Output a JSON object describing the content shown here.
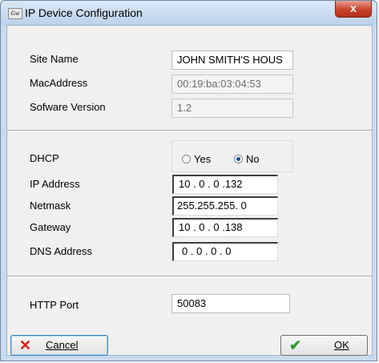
{
  "window": {
    "title": "IP Device Configuration",
    "app_icon_text": "Gw",
    "close_glyph": "x"
  },
  "device": {
    "site_name_label": "Site Name",
    "site_name_value": "JOHN SMITH'S HOUS",
    "mac_label": "MacAddress",
    "mac_value": "00:19:ba:03:04:53",
    "software_label": "Sofware Version",
    "software_value": "1.2"
  },
  "network": {
    "dhcp_label": "DHCP",
    "dhcp_yes_label": "Yes",
    "dhcp_no_label": "No",
    "dhcp_selected": "No",
    "ip_label": "IP Address",
    "ip_value": "10 . 0 . 0 .132",
    "netmask_label": "Netmask",
    "netmask_value": "255.255.255. 0",
    "gateway_label": "Gateway",
    "gateway_value": "10 . 0 . 0 .138",
    "dns_label": "DNS Address",
    "dns_value": "0 . 0 . 0 . 0"
  },
  "http": {
    "port_label": "HTTP Port",
    "port_value": "50083"
  },
  "buttons": {
    "cancel_label": "Cancel",
    "ok_label": "OK"
  },
  "colors": {
    "cancel_icon": "#d6201a",
    "ok_icon": "#2e9a2e",
    "title_bar": "#c9dbee",
    "close_button": "#c8442b"
  }
}
